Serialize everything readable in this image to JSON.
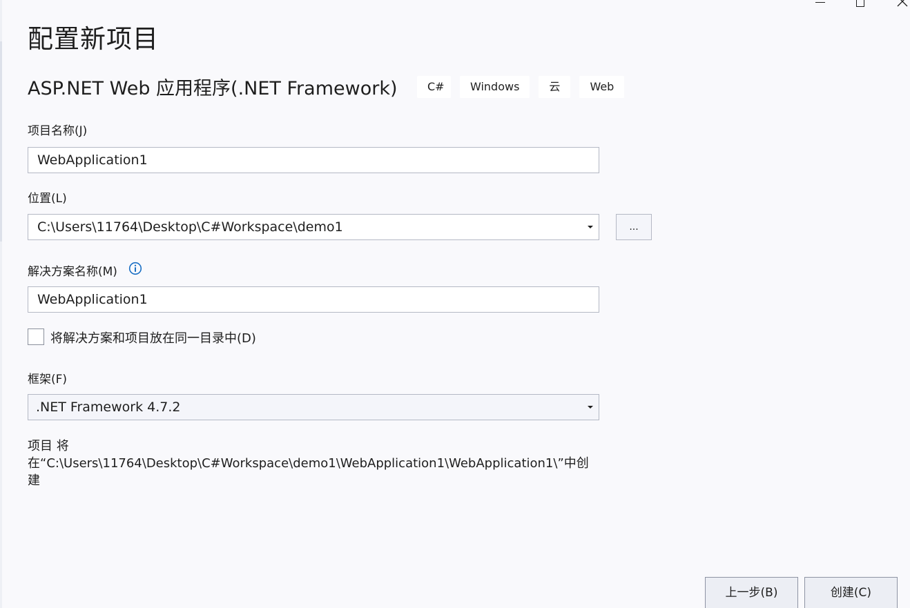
{
  "window": {
    "title": "配置新项目"
  },
  "project_type": {
    "name": "ASP.NET Web 应用程序(.NET Framework)",
    "tags": [
      "C#",
      "Windows",
      "云",
      "Web"
    ]
  },
  "project_name": {
    "label": "项目名称(J)",
    "value": "WebApplication1"
  },
  "location": {
    "label": "位置(L)",
    "value": "C:\\Users\\11764\\Desktop\\C#Workspace\\demo1",
    "browse_label": "..."
  },
  "solution_name": {
    "label": "解决方案名称(M)",
    "value": "WebApplication1"
  },
  "same_dir": {
    "label": "将解决方案和项目放在同一目录中(D)",
    "checked": false
  },
  "framework": {
    "label": "框架(F)",
    "value": ".NET Framework 4.7.2"
  },
  "path_note": "项目 将在“C:\\Users\\11764\\Desktop\\C#Workspace\\demo1\\WebApplication1\\WebApplication1\\”中创建",
  "buttons": {
    "back": "上一步(B)",
    "create": "创建(C)"
  }
}
